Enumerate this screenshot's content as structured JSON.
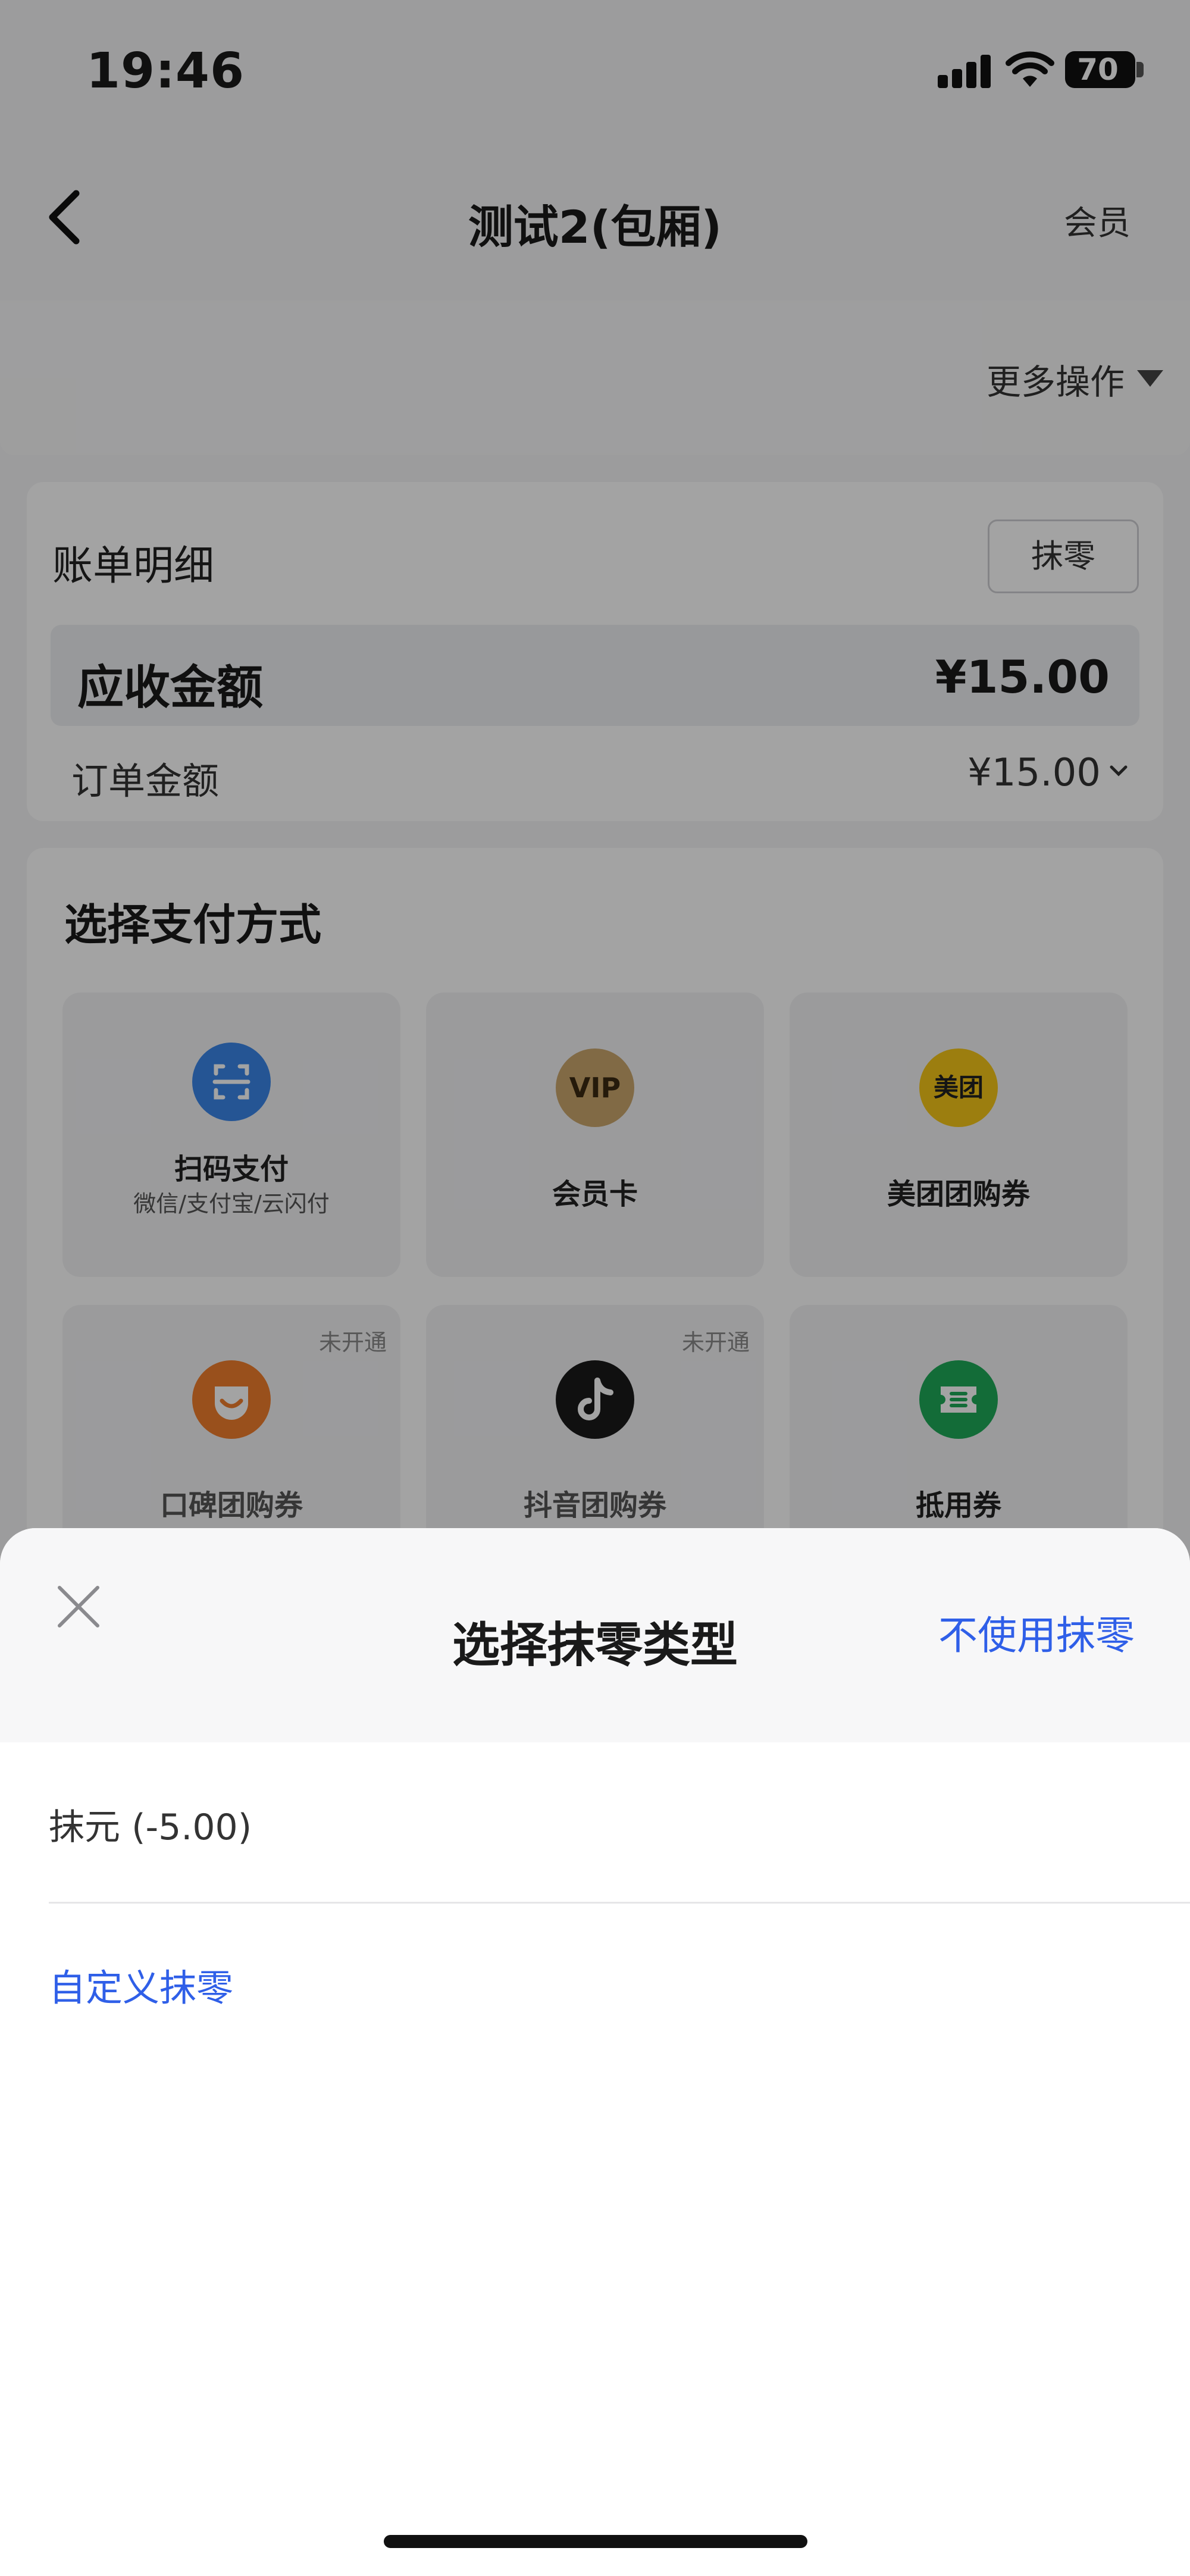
{
  "status_bar": {
    "time": "19:46",
    "battery": "70"
  },
  "nav": {
    "title": "测试2(包厢)",
    "right_label": "会员",
    "more_actions": "更多操作"
  },
  "bill": {
    "title": "账单明细",
    "round_button": "抹零",
    "due_label": "应收金额",
    "due_value": "¥15.00",
    "order_label": "订单金额",
    "order_value": "¥15.00"
  },
  "payment": {
    "title": "选择支付方式",
    "methods": [
      {
        "label": "扫码支付",
        "sub": "微信/支付宝/云闪付",
        "icon": "scan-icon",
        "color": "#3a86e8"
      },
      {
        "label": "会员卡",
        "icon": "vip-icon",
        "icon_text": "VIP",
        "color": "#caa66d"
      },
      {
        "label": "美团团购券",
        "icon": "meituan-icon",
        "icon_text": "美团",
        "color": "#f5c518"
      },
      {
        "label": "口碑团购券",
        "tag": "未开通",
        "icon": "koubei-icon",
        "color": "#f07d2c"
      },
      {
        "label": "抖音团购券",
        "tag": "未开通",
        "icon": "douyin-icon",
        "color": "#1a1a1a"
      },
      {
        "label": "抵用券",
        "icon": "voucher-icon",
        "color": "#1faa58"
      }
    ]
  },
  "sheet": {
    "title": "选择抹零类型",
    "no_round": "不使用抹零",
    "options": [
      "抹元 (-5.00)",
      "自定义抹零"
    ]
  },
  "colors": {
    "accent": "#2f5fe8"
  }
}
